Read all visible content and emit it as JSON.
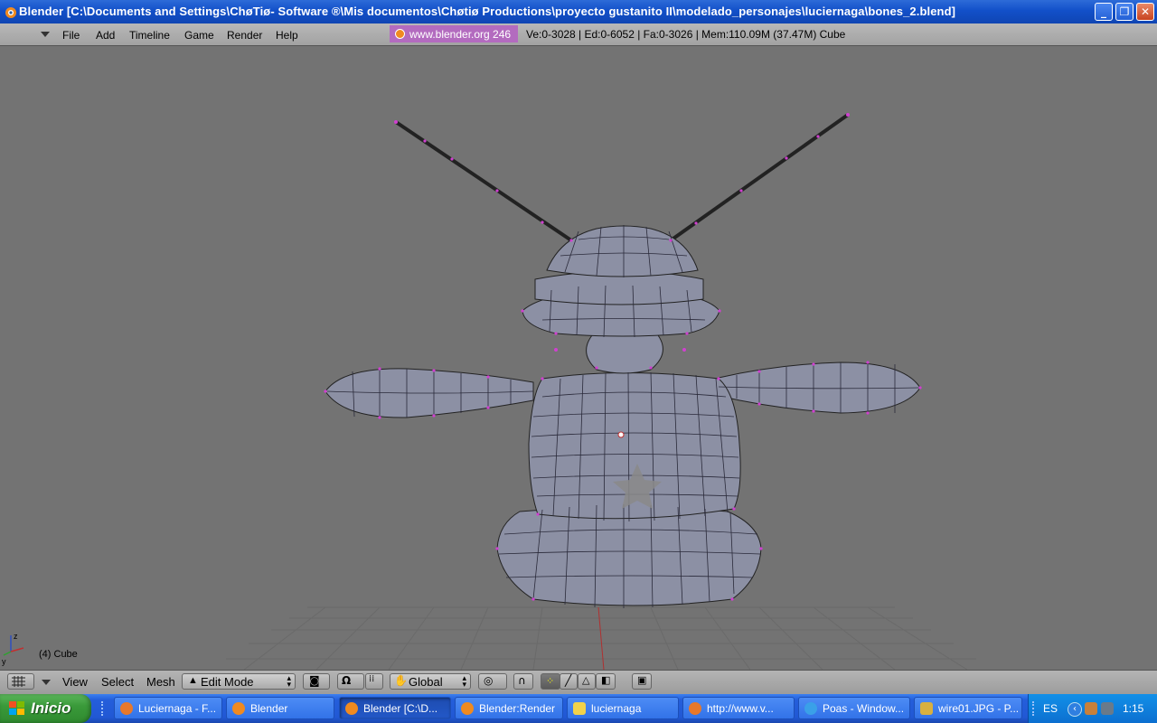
{
  "window": {
    "title": "Blender [C:\\Documents and Settings\\ChøTiø- Software ®\\Mis documentos\\Chøtiø Productions\\proyecto gustanito II\\modelado_personajes\\luciernaga\\bones_2.blend]"
  },
  "header": {
    "menus": [
      "File",
      "Add",
      "Timeline",
      "Game",
      "Render",
      "Help"
    ],
    "logo_text": "www.blender.org 246",
    "stats": "Ve:0-3028 | Ed:0-6052 | Fa:0-3026 | Mem:110.09M (37.47M) Cube"
  },
  "viewport": {
    "object_label": "(4) Cube",
    "axis_labels": {
      "z": "z",
      "y": "y"
    }
  },
  "bottombar": {
    "menus": [
      "View",
      "Select",
      "Mesh"
    ],
    "mode": "Edit Mode",
    "orientation": "Global"
  },
  "taskbar": {
    "start_label": "Inicio",
    "tasks": [
      {
        "label": "Luciernaga - F...",
        "icon": "firefox-icon",
        "color": "#e8782a"
      },
      {
        "label": "Blender",
        "icon": "blender-icon",
        "color": "#f08a20"
      },
      {
        "label": "Blender [C:\\D...",
        "icon": "blender-icon",
        "color": "#f08a20"
      },
      {
        "label": "Blender:Render",
        "icon": "blender-icon",
        "color": "#f08a20"
      },
      {
        "label": "luciernaga",
        "icon": "folder-icon",
        "color": "#f2d24a"
      },
      {
        "label": "http://www.v...",
        "icon": "firefox-icon",
        "color": "#e8782a"
      },
      {
        "label": "Poas - Window...",
        "icon": "ie-icon",
        "color": "#3aa0e8"
      },
      {
        "label": "wire01.JPG - P...",
        "icon": "paint-icon",
        "color": "#d8b040"
      }
    ],
    "tray": {
      "lang": "ES",
      "clock": "1:15"
    }
  },
  "colors": {
    "viewport_bg": "#737373",
    "mesh_fill": "#8c8fa0",
    "vertex": "#d040d0",
    "axis_x": "#c03030",
    "axis_y": "#30a030"
  }
}
